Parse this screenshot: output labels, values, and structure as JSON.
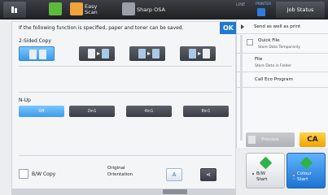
{
  "topbar": {
    "easy_scan": "Easy\nScan",
    "sharp_osa": "Sharp OSA",
    "line": "LINE",
    "printer": "PRINTER",
    "job_status": "Job Status"
  },
  "main": {
    "info_text": "If the following function is specified, paper and toner can be saved.",
    "ok_label": "OK",
    "two_sided_label": "2-Sided Copy",
    "nup_label": "N-Up",
    "nup_options": [
      "Off",
      "2in1",
      "4in1",
      "8in1"
    ],
    "nup_selected": "Off",
    "bw_copy_label": "B/W Copy",
    "original_orientation_label": "Original\nOrientation",
    "orientation_options": [
      "A",
      "⋖"
    ]
  },
  "right": {
    "send_label": "Send as well as print",
    "quick_file_title": "Quick File",
    "quick_file_sub": "Store Data Temporarily",
    "file_title": "File",
    "file_sub": "Store Data in Folder",
    "call_eco_label": "Call Eco Program",
    "preview_label": "Preview",
    "ca_label": "CA",
    "bw_start_label": "B/W\nStart",
    "color_start_label": "Colour\nStart"
  },
  "colors": {
    "accent_blue": "#1f78d1",
    "selected_blue": "#3b9be8",
    "ca_yellow": "#f0a400",
    "start_green": "#2fb24a"
  }
}
